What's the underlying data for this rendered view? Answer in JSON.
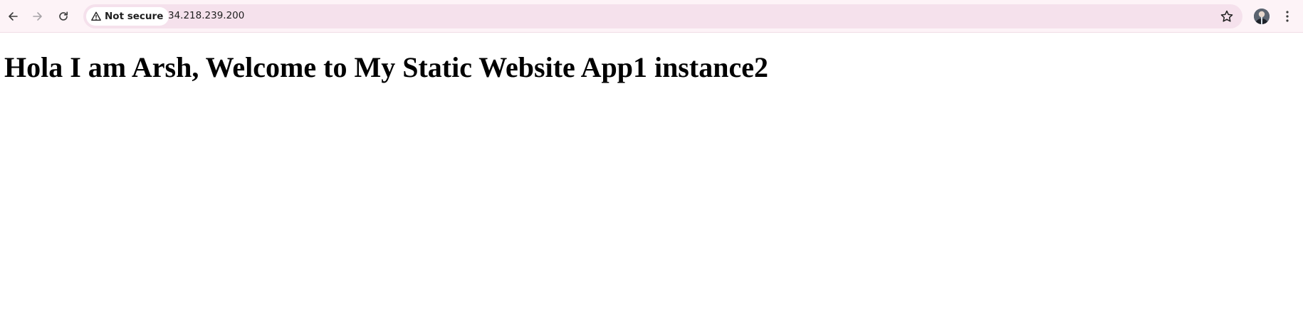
{
  "browser": {
    "security_label": "Not secure",
    "url": "34.218.239.200"
  },
  "icons": {
    "back": "back-arrow-icon",
    "forward": "forward-arrow-icon",
    "reload": "reload-icon",
    "warning": "warning-triangle-icon",
    "bookmark": "star-icon",
    "profile": "avatar",
    "menu": "kebab-menu-icon"
  },
  "colors": {
    "toolbar_bg": "#fdf3f7",
    "omnibox_bg": "#f5e1ec",
    "page_bg": "#ffffff",
    "heading_text": "#000000"
  },
  "page": {
    "heading": "Hola I am Arsh, Welcome to My Static Website App1 instance2"
  }
}
